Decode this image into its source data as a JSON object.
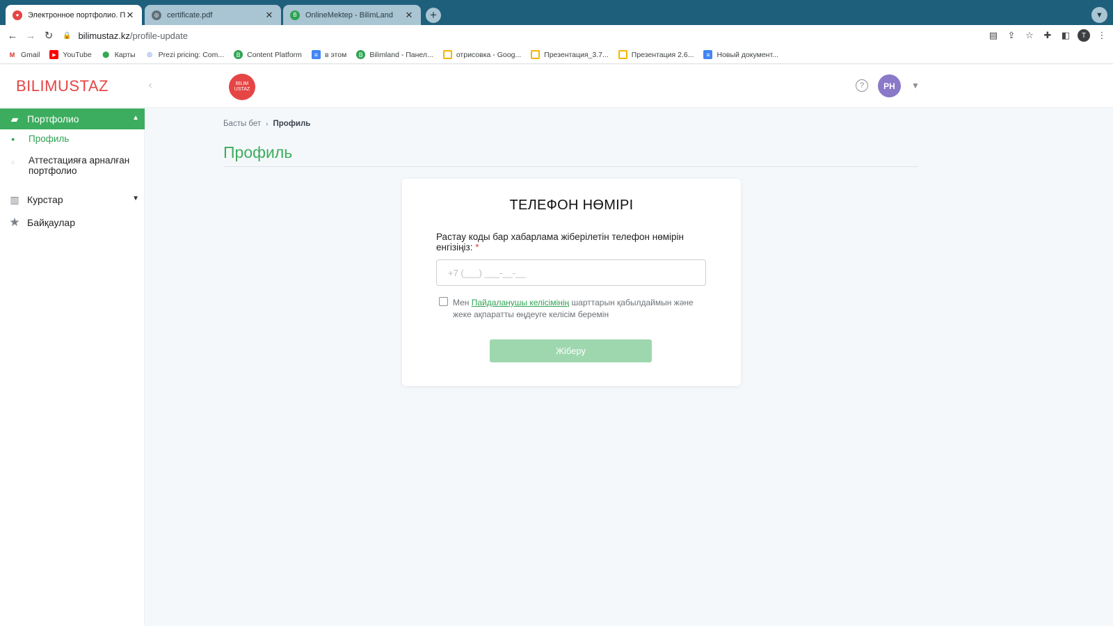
{
  "browser": {
    "tabs": [
      {
        "title": "Электронное портфолио. Пол",
        "active": true
      },
      {
        "title": "certificate.pdf",
        "active": false
      },
      {
        "title": "OnlineMektep - BilimLand",
        "active": false
      }
    ],
    "url_host": "bilimustaz.kz",
    "url_path": "/profile-update",
    "profile_initial": "T",
    "bookmarks": [
      {
        "label": "Gmail",
        "icon": "gmail-icon"
      },
      {
        "label": "YouTube",
        "icon": "youtube-icon"
      },
      {
        "label": "Карты",
        "icon": "maps-pin-icon"
      },
      {
        "label": "Prezi pricing: Com...",
        "icon": "prezi-icon"
      },
      {
        "label": "Content Platform",
        "icon": "bilimland-icon"
      },
      {
        "label": "в этом",
        "icon": "doc-icon"
      },
      {
        "label": "Bilimland - Панел...",
        "icon": "bilimland-icon"
      },
      {
        "label": "отрисовка - Goog...",
        "icon": "slides-icon"
      },
      {
        "label": "Презентация_3.7...",
        "icon": "slides-icon"
      },
      {
        "label": "Презентация 2.6...",
        "icon": "slides-icon"
      },
      {
        "label": "Новый документ...",
        "icon": "doc-icon"
      }
    ]
  },
  "header": {
    "brand": "BILIMUSTAZ",
    "logo_text": "BILIM USTAZ",
    "user_initials": "PH",
    "colors": {
      "brand": "#e64545",
      "accent": "#3cad5e",
      "avatar": "#8a79c8"
    }
  },
  "sidebar": {
    "portfolio": {
      "label": "Портфолио",
      "icon": "briefcase-icon",
      "items": [
        {
          "label": "Профиль",
          "current": true
        },
        {
          "label": "Аттестацияға арналған портфолио",
          "current": false
        }
      ]
    },
    "courses": {
      "label": "Курстар",
      "icon": "book-icon"
    },
    "contests": {
      "label": "Байқаулар",
      "icon": "star-icon"
    }
  },
  "main": {
    "breadcrumb": {
      "home": "Басты бет",
      "current": "Профиль"
    },
    "title": "Профиль",
    "card": {
      "title": "ТЕЛЕФОН НӨМІРІ",
      "label": "Растау коды бар хабарлама жіберілетін телефон нөмірін енгізіңіз:",
      "required_mark": "*",
      "phone_placeholder": "+7 (___) ___-__-__",
      "agree_prefix": "Мен",
      "agree_link": "Пайдаланушы келісімінің",
      "agree_suffix": "шарттарын қабылдаймын және жеке ақпаратты өңдеуге келісім беремін",
      "submit": "Жіберу"
    }
  }
}
